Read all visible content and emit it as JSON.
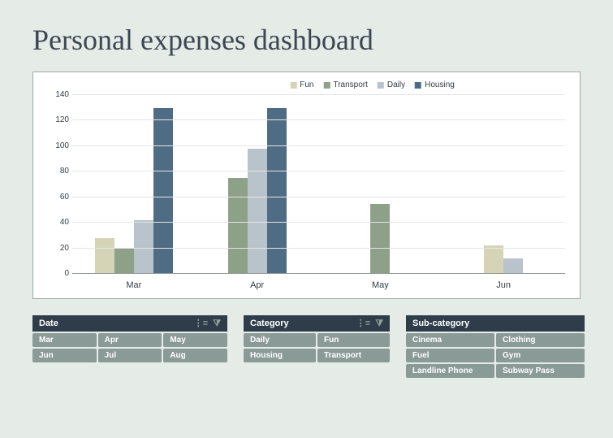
{
  "title": "Personal expenses dashboard",
  "chart_data": {
    "type": "bar",
    "categories": [
      "Mar",
      "Apr",
      "May",
      "Jun"
    ],
    "series": [
      {
        "name": "Fun",
        "color": "#d6d4b7",
        "values": [
          28,
          0,
          0,
          22
        ]
      },
      {
        "name": "Transport",
        "color": "#8da088",
        "values": [
          20,
          75,
          55,
          0
        ]
      },
      {
        "name": "Daily",
        "color": "#b9c3cb",
        "values": [
          42,
          98,
          0,
          12
        ]
      },
      {
        "name": "Housing",
        "color": "#4f6c85",
        "values": [
          130,
          130,
          0,
          0
        ]
      }
    ],
    "ylim": [
      0,
      140
    ],
    "yticks": [
      0,
      20,
      40,
      60,
      80,
      100,
      120,
      140
    ],
    "title": "",
    "xlabel": "",
    "ylabel": ""
  },
  "legend": [
    "Fun",
    "Transport",
    "Daily",
    "Housing"
  ],
  "slicers": {
    "date": {
      "title": "Date",
      "items": [
        "Mar",
        "Apr",
        "May",
        "Jun",
        "Jul",
        "Aug"
      ]
    },
    "category": {
      "title": "Category",
      "items": [
        "Daily",
        "Fun",
        "Housing",
        "Transport"
      ]
    },
    "subcategory": {
      "title": "Sub-category",
      "items": [
        "Cinema",
        "Clothing",
        "Fuel",
        "Gym",
        "Landline Phone",
        "Subway Pass"
      ]
    }
  }
}
